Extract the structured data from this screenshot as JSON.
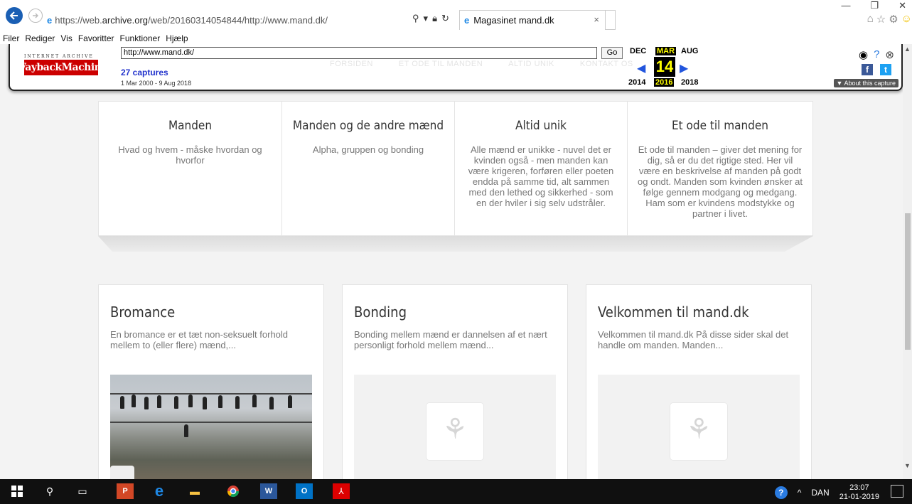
{
  "browser": {
    "address_prefix": "https://web.",
    "address_domain": "archive.org",
    "address_rest": "/web/20160314054844/http://www.mand.dk/",
    "tab_title": "Magasinet mand.dk",
    "menu": [
      "Filer",
      "Rediger",
      "Vis",
      "Favoritter",
      "Funktioner",
      "Hjælp"
    ]
  },
  "wayback": {
    "logo_top": "INTERNET ARCHIVE",
    "logo": "WaybackMachine",
    "url_value": "http://www.mand.dk/",
    "go_label": "Go",
    "captures": "27 captures",
    "range": "1 Mar 2000 - 9 Aug 2018",
    "months": {
      "prev": "DEC",
      "current": "MAR",
      "next": "AUG"
    },
    "day": "14",
    "years": {
      "prev": "2014",
      "current": "2016",
      "next": "2018"
    },
    "about": "▼ About this capture",
    "ghost_nav": [
      "FORSIDEN",
      "ET ODE TIL MANDEN",
      "ALTID UNIK",
      "KONTAKT OS"
    ]
  },
  "features": [
    {
      "title": "Manden",
      "text": "Hvad og hvem - måske hvordan og hvorfor"
    },
    {
      "title": "Manden og de andre mænd",
      "text": "Alpha, gruppen og bonding"
    },
    {
      "title": "Altid unik",
      "text": "Alle mænd er unikke - nuvel det er kvinden også - men manden kan være krigeren, forføren eller poeten endda på samme tid, alt sammen med den lethed og sikkerhed - som en der hviler i sig selv udstråler."
    },
    {
      "title": "Et ode til manden",
      "text": "Et ode til manden – giver det mening for dig, så er du det rigtige sted. Her vil være en beskrivelse af manden på godt og ondt. Manden som kvinden ønsker at følge gennem modgang og medgang. Ham som er kvindens modstykke og partner i livet."
    }
  ],
  "cards": [
    {
      "title": "Bromance",
      "text": "En bromance er et tæt non-seksuelt forhold mellem to (eller flere) mænd,..."
    },
    {
      "title": "Bonding",
      "text": "Bonding mellem mænd er dannelsen af et nært personligt forhold mellem mænd..."
    },
    {
      "title": "Velkommen til mand.dk",
      "text": "Velkommen til mand.dk På disse sider skal det handle om manden. Manden..."
    }
  ],
  "taskbar": {
    "lang": "DAN",
    "time": "23:07",
    "date": "21-01-2019"
  }
}
